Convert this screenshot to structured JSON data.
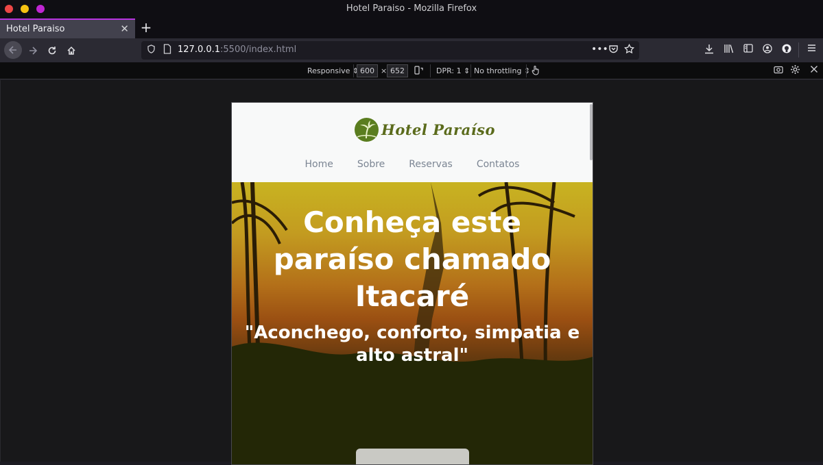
{
  "window": {
    "title": "Hotel Paraiso - Mozilla Firefox"
  },
  "tab": {
    "title": "Hotel Paraiso",
    "close": "✕",
    "new": "+"
  },
  "urlbar": {
    "host": "127.0.0.1",
    "rest": ":5500/index.html"
  },
  "rdm": {
    "mode": "Responsive ⇕",
    "width": "600",
    "times": "×",
    "height": "652",
    "dpr": "DPR: 1 ⇕",
    "throttle": "No throttling ⇕"
  },
  "site": {
    "logo_text": "Hotel Paraíso",
    "nav": [
      "Home",
      "Sobre",
      "Reservas",
      "Contatos"
    ],
    "hero_title": "Conheça este paraíso chamado Itacaré",
    "hero_subtitle": "\"Aconchego, conforto, simpatia e alto astral\""
  },
  "colors": {
    "tab_accent": "#b833e1",
    "logo_green": "#5a7d1f"
  }
}
